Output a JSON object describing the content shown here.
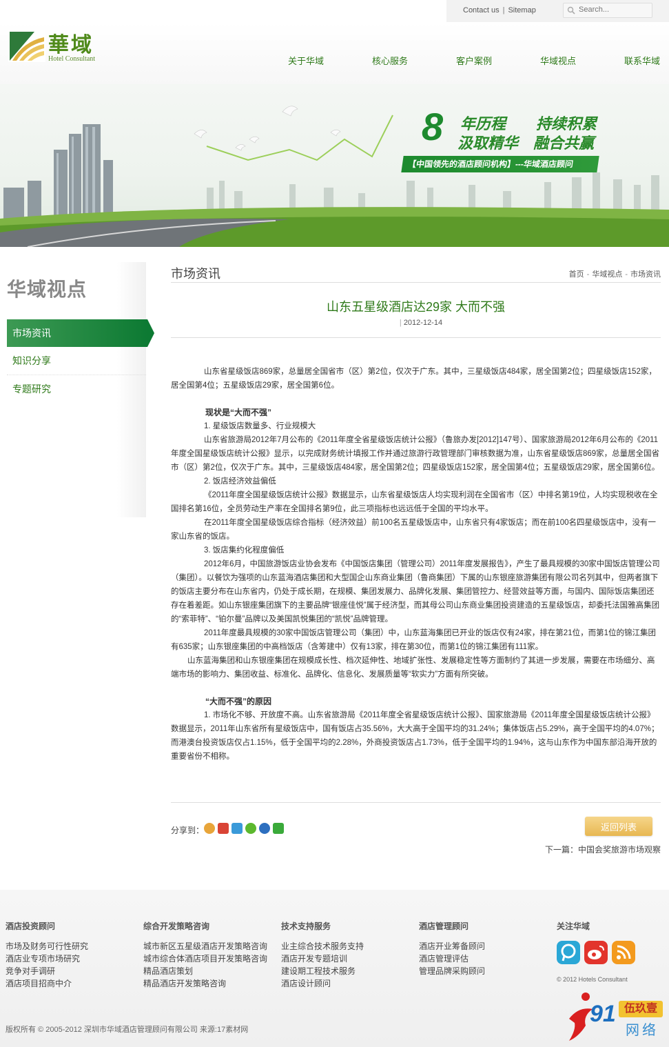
{
  "topbar": {
    "contact": "Contact us",
    "separator": "|",
    "sitemap": "Sitemap",
    "search_placeholder": "Search..."
  },
  "logo": {
    "cn": "華域",
    "en": "Hotel Consultant"
  },
  "nav": {
    "items": [
      {
        "label": "关于华域"
      },
      {
        "label": "核心服务"
      },
      {
        "label": "客户案例"
      },
      {
        "label": "华域视点"
      },
      {
        "label": "联系华域"
      }
    ]
  },
  "banner": {
    "number": "8",
    "line1a": "年历程",
    "line1b": "持续积累",
    "line2a": "汲取精华",
    "line2b": "融合共赢",
    "ribbon": "【中国领先的酒店顾问机构】---华域酒店顾问"
  },
  "sidebar": {
    "title": "华域视点",
    "items": [
      {
        "label": "市场资讯"
      },
      {
        "label": "知识分享"
      },
      {
        "label": "专题研究"
      }
    ]
  },
  "main": {
    "section_title": "市场资讯",
    "breadcrumb": [
      "首页",
      "华域视点",
      "市场资讯"
    ],
    "breadcrumb_arrow": "-",
    "article_title": "山东五星级酒店达29家 大而不强",
    "article_date": "2012-12-14",
    "paragraphs": {
      "p1": "山东省星级饭店869家，总量居全国省市（区）第2位，仅次于广东。其中，三星级饭店484家，居全国第2位；四星级饭店152家，居全国第4位；五星级饭店29家，居全国第6位。",
      "h1": "现状是“大而不强”",
      "s1": "1. 星级饭店数量多、行业规模大",
      "p2": "山东省旅游局2012年7月公布的《2011年度全省星级饭店统计公报》（鲁旅办发[2012]147号）、国家旅游局2012年6月公布的《2011年度全国星级饭店统计公报》显示，以完成财务统计填报工作并通过旅游行政管理部门审核数据为准，山东省星级饭店869家，总量居全国省市（区）第2位，仅次于广东。其中，三星级饭店484家，居全国第2位；四星级饭店152家，居全国第4位；五星级饭店29家，居全国第6位。",
      "s2": "2. 饭店经济效益偏低",
      "p3": "《2011年度全国星级饭店统计公报》数据显示，山东省星级饭店人均实现利润在全国省市（区）中排名第19位，人均实现税收在全国排名第16位，全员劳动生产率在全国排名第9位，此三项指标也远远低于全国的平均水平。",
      "p4": "在2011年度全国星级饭店综合指标（经济效益）前100名五星级饭店中，山东省只有4家饭店；而在前100名四星级饭店中，没有一家山东省的饭店。",
      "s3": "3. 饭店集约化程度偏低",
      "p5": "2012年6月，中国旅游饭店业协会发布《中国饭店集团（管理公司）2011年度发展报告》，产生了最具规模的30家中国饭店管理公司（集团）。以餐饮为强项的山东蓝海酒店集团和大型国企山东商业集团（鲁商集团）下属的山东银座旅游集团有限公司名列其中，但两者旗下的饭店主要分布在山东省内，仍处于成长期，在规模、集团发展力、品牌化发展、集团管控力、经营效益等方面，与国内、国际饭店集团还存在着差距。如山东银座集团旗下的主要品牌“银座佳悦”属于经济型，而其母公司山东商业集团投资建造的五星级饭店，却委托法国雅高集团的“索菲特”、“铂尔曼”品牌以及美国凯悦集团的“凯悦”品牌管理。",
      "p6": "2011年度最具规模的30家中国饭店管理公司（集团）中，山东蓝海集团已开业的饭店仅有24家，排在第21位，而第1位的锦江集团有635家；山东银座集团的中高档饭店（含筹建中）仅有13家，排在第30位，而第1位的锦江集团有111家。",
      "p7": "山东蓝海集团和山东银座集团在规模成长性、档次延伸性、地域扩张性、发展稳定性等方面制约了其进一步发展，需要在市场细分、高端市场的影响力、集团收益、标准化、品牌化、信息化、发展质量等“软实力”方面有所突破。",
      "h2": "“大而不强”的原因",
      "p8": "1. 市场化不够、开放度不高。山东省旅游局《2011年度全省星级饭店统计公报》、国家旅游局《2011年度全国星级饭店统计公报》数据显示，2011年山东省所有星级饭店中，国有饭店占35.56%，大大高于全国平均的31.24%；集体饭店占5.29%，高于全国平均的4.07%；而港澳台投资饭店仅占1.15%，低于全国平均的2.28%，外商投资饭店占1.73%，低于全国平均的1.94%，这与山东作为中国东部沿海开放的重要省份不相称。"
    },
    "share_label": "分享到：",
    "back_button": "返回列表",
    "next_label": "下一篇：",
    "next_title": "中国会奖旅游市场观察"
  },
  "footer": {
    "columns": [
      {
        "heading": "酒店投资顾问",
        "links": [
          "市场及财务可行性研究",
          "酒店业专项市场研究",
          "竞争对手调研",
          "酒店项目招商中介"
        ]
      },
      {
        "heading": "综合开发策略咨询",
        "links": [
          "城市新区五星级酒店开发策略咨询",
          "城市综合体酒店项目开发策略咨询",
          "精品酒店策划",
          "精品酒店开发策略咨询"
        ]
      },
      {
        "heading": "技术支持服务",
        "links": [
          "业主综合技术服务支持",
          "酒店开发专题培训",
          "建设期工程技术服务",
          "酒店设计顾问"
        ]
      },
      {
        "heading": "酒店管理顾问",
        "links": [
          "酒店开业筹备顾问",
          "酒店管理评估",
          "管理品牌采购顾问"
        ]
      }
    ],
    "follow_heading": "关注华域",
    "small_copyright": "© 2012 Hotels Consultant",
    "copyright": "版权所有 © 2005-2012 深圳市华域酒店管理顾问有限公司 来源:17素材网",
    "brand": {
      "num": "91",
      "cn_top": "伍玖壹",
      "cn_bottom": "网络"
    }
  },
  "colors": {
    "brand_green": "#2f7a1a",
    "active_green": "#0d7a33",
    "button_gold": "#e7b752"
  }
}
